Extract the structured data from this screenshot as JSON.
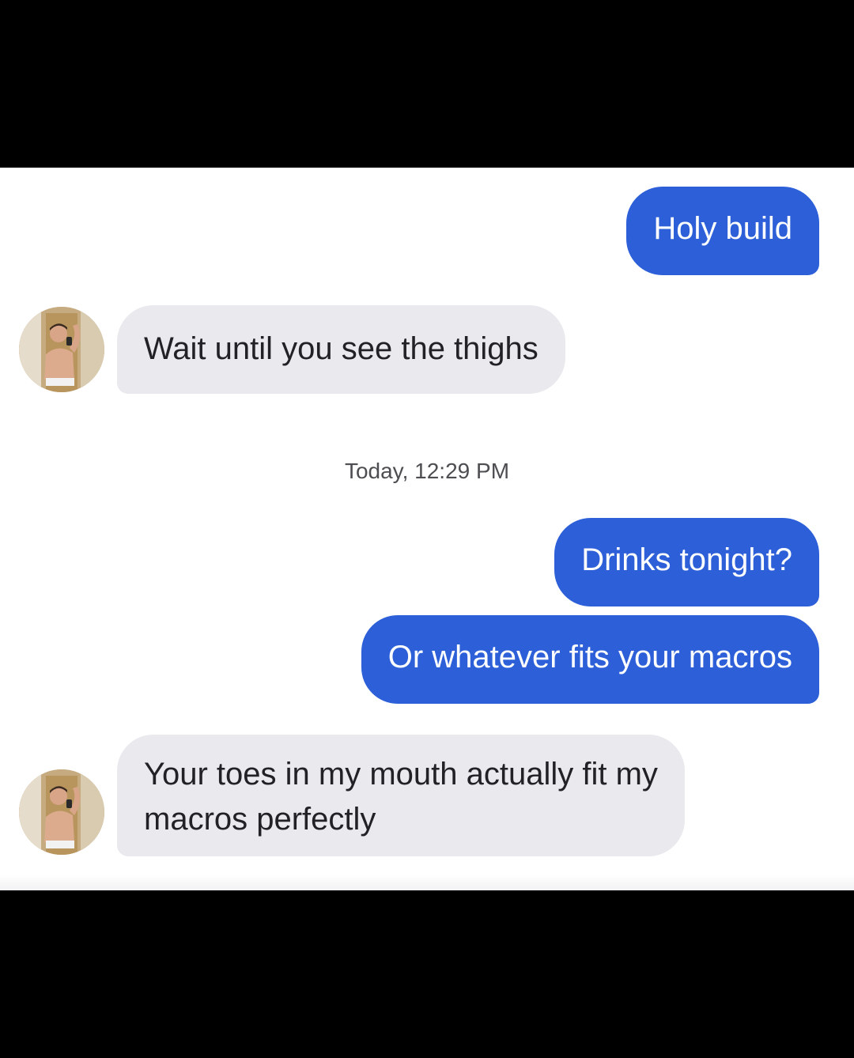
{
  "messages": [
    {
      "sender": "me",
      "text": "Holy build"
    },
    {
      "sender": "them",
      "text": "Wait until you see the thighs",
      "avatar_icon": "profile-photo-icon"
    },
    {
      "timestamp": "Today, 12:29 PM"
    },
    {
      "sender": "me",
      "text": "Drinks tonight?"
    },
    {
      "sender": "me",
      "text": "Or whatever fits your macros"
    },
    {
      "sender": "them",
      "lines": [
        "Your toes in my mouth actually fit my",
        "macros perfectly"
      ],
      "avatar_icon": "profile-photo-icon"
    }
  ],
  "colors": {
    "sent_bubble": "#2c5fd8",
    "received_bubble": "#e9e9ee",
    "background": "#ffffff",
    "letterbox": "#000000"
  }
}
